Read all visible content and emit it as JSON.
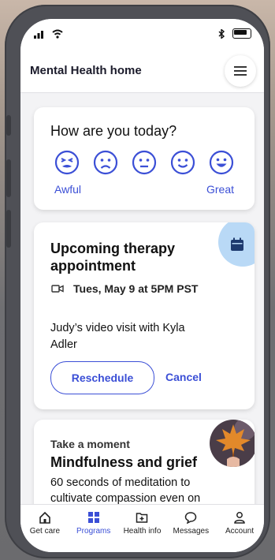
{
  "status": {
    "signal_icon": "signal-bars-icon",
    "wifi_icon": "wifi-icon",
    "bluetooth_icon": "bluetooth-icon",
    "battery_icon": "battery-icon"
  },
  "header": {
    "title": "Mental Health home",
    "menu_icon": "hamburger-menu-icon"
  },
  "mood": {
    "question": "How are you today?",
    "low_label": "Awful",
    "high_label": "Great",
    "faces": [
      "awful-face-icon",
      "sad-face-icon",
      "neutral-face-icon",
      "happy-face-icon",
      "great-face-icon"
    ],
    "accent": "#3b4fd6"
  },
  "appointment": {
    "title": "Upcoming therapy appointment",
    "time": "Tues, May 9 at 5PM PST",
    "description": "Judy’s video visit with Kyla Adler",
    "reschedule_label": "Reschedule",
    "cancel_label": "Cancel",
    "calendar_icon": "calendar-icon",
    "video_icon": "video-camera-icon"
  },
  "mindfulness": {
    "kicker": "Take a moment",
    "title": "Mindfulness and grief",
    "description": "60 seconds of meditation to cultivate compassion even on"
  },
  "tabs": [
    {
      "label": "Get care",
      "icon": "home-icon",
      "active": false
    },
    {
      "label": "Programs",
      "icon": "grid-icon",
      "active": true
    },
    {
      "label": "Health info",
      "icon": "plus-folder-icon",
      "active": false
    },
    {
      "label": "Messages",
      "icon": "chat-bubble-icon",
      "active": false
    },
    {
      "label": "Account",
      "icon": "person-icon",
      "active": false
    }
  ]
}
